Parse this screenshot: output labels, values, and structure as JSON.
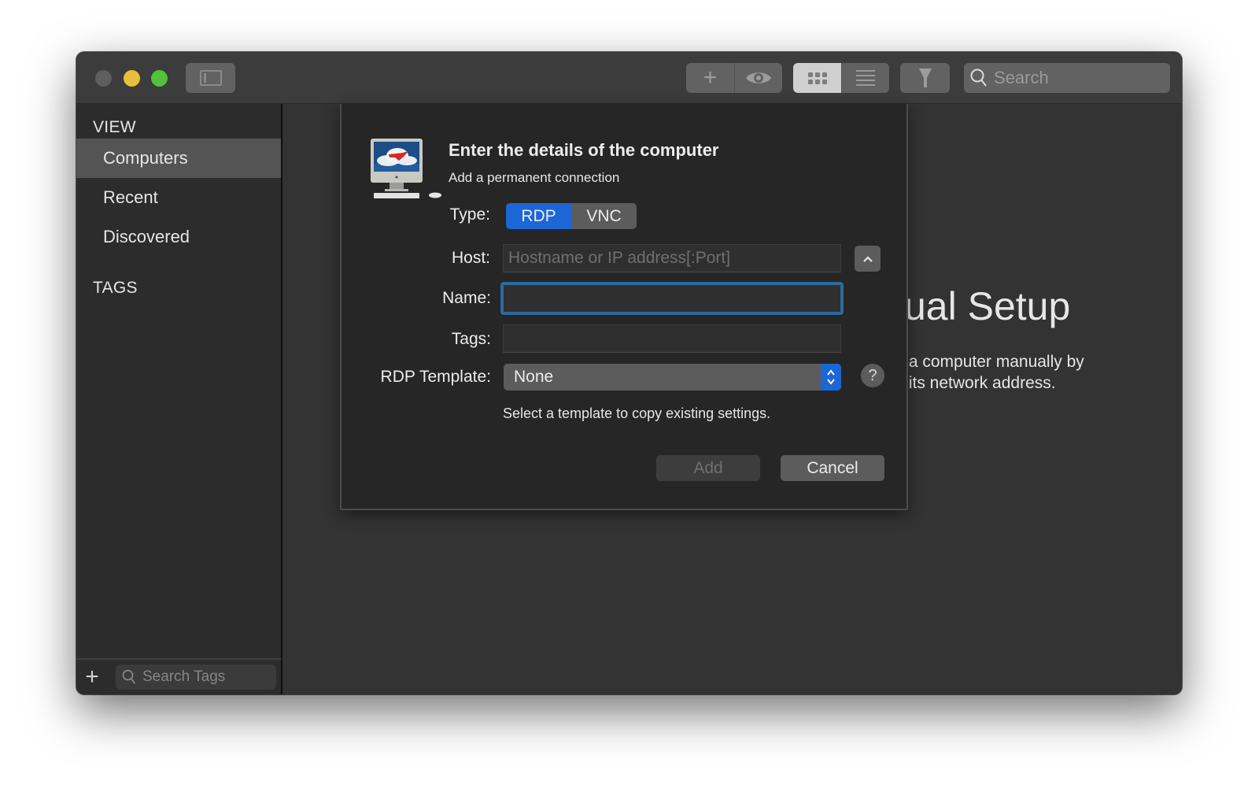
{
  "window": {
    "traffic_lights": {
      "close": "#5e5e5e",
      "minimize": "#e8bf3c",
      "maximize": "#52c13b"
    }
  },
  "toolbar": {
    "sidebar_toggle_icon": "sidebar-icon",
    "add_icon": "plus-icon",
    "preview_icon": "eye-icon",
    "view_modes": [
      {
        "name": "grid",
        "icon": "grid-icon",
        "active": true
      },
      {
        "name": "list",
        "icon": "list-icon",
        "active": false
      }
    ],
    "filter_icon": "filter-icon",
    "search": {
      "placeholder": "Search",
      "value": ""
    }
  },
  "sidebar": {
    "view_heading": "VIEW",
    "items": [
      {
        "label": "Computers",
        "selected": true
      },
      {
        "label": "Recent",
        "selected": false
      },
      {
        "label": "Discovered",
        "selected": false
      }
    ],
    "tags_heading": "TAGS",
    "footer": {
      "add_icon": "plus-icon",
      "tag_search_placeholder": "Search Tags",
      "tag_search_value": ""
    }
  },
  "background": {
    "title": "ual Setup",
    "description_line1": " a computer manually by",
    "description_line2": " its network address."
  },
  "sheet": {
    "title": "Enter the details of the computer",
    "subtitle": "Add a permanent connection",
    "type_label": "Type:",
    "type_options": [
      {
        "label": "RDP",
        "active": true
      },
      {
        "label": "VNC",
        "active": false
      }
    ],
    "host_label": "Host:",
    "host_placeholder": "Hostname or IP address[:Port]",
    "host_value": "",
    "name_label": "Name:",
    "name_value": "",
    "tags_label": "Tags:",
    "tags_value": "",
    "template_label": "RDP Template:",
    "template_selected": "None",
    "template_hint": "Select a template to copy existing settings.",
    "help_label": "?",
    "add_label": "Add",
    "add_enabled": false,
    "cancel_label": "Cancel",
    "accent_color": "#1c66d6",
    "focus_color": "#2a6a9c"
  }
}
